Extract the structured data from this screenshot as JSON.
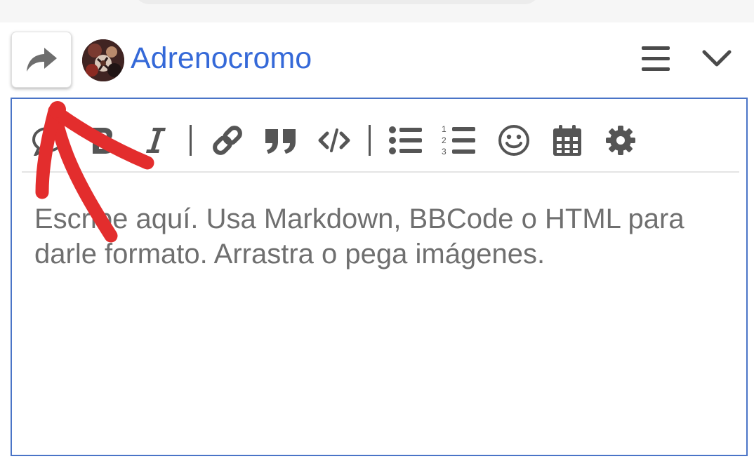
{
  "header": {
    "username": "Adrenocromo",
    "user_color": "#3569d8"
  },
  "editor": {
    "placeholder": "Escribe aquí. Usa Markdown, BBCode o HTML para darle formato. Arrastra o pega imágenes.",
    "border_color": "#4a74c7",
    "toolbar": [
      {
        "name": "quote-whole-post",
        "icon": "speech-bubble-icon"
      },
      {
        "name": "bold",
        "icon": "bold-icon"
      },
      {
        "name": "italic",
        "icon": "italic-icon"
      },
      {
        "name": "link",
        "icon": "link-icon"
      },
      {
        "name": "blockquote",
        "icon": "quote-icon"
      },
      {
        "name": "preformatted-text",
        "icon": "code-icon"
      },
      {
        "name": "bulleted-list",
        "icon": "bullet-list-icon"
      },
      {
        "name": "numbered-list",
        "icon": "numbered-list-icon"
      },
      {
        "name": "emoji",
        "icon": "smiley-icon"
      },
      {
        "name": "insert-date",
        "icon": "calendar-icon"
      },
      {
        "name": "options",
        "icon": "gear-icon"
      }
    ]
  },
  "annotation": {
    "type": "hand-drawn arrow",
    "color": "#e32d2d"
  },
  "icon_color": "#555555"
}
